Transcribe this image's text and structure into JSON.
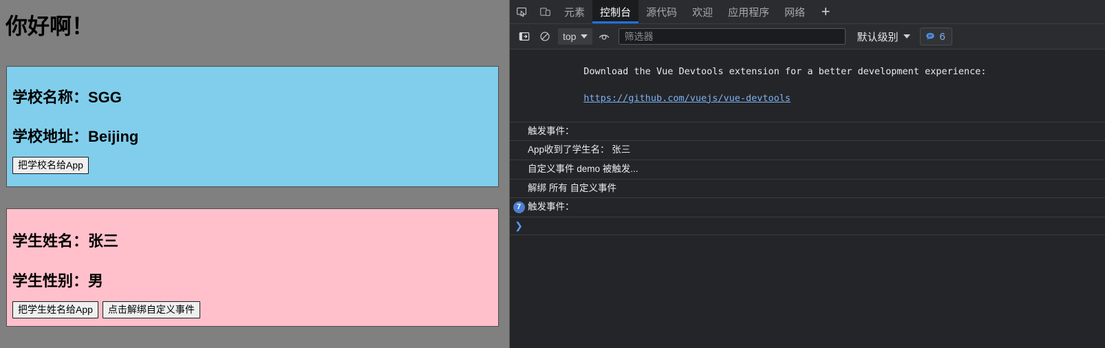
{
  "webpage": {
    "title": "你好啊！",
    "school_card": {
      "name_line": "学校名称：SGG",
      "address_line": "学校地址：Beijing",
      "button_label": "把学校名给App"
    },
    "student_card": {
      "name_line": "学生姓名：张三",
      "gender_line": "学生性别：男",
      "button_send_label": "把学生姓名给App",
      "button_unbind_label": "点击解绑自定义事件"
    },
    "colors": {
      "background": "#808080",
      "school_card": "#80ceeb",
      "student_card": "#ffc0cb"
    }
  },
  "devtools": {
    "tabs": [
      {
        "label": "元素",
        "active": false
      },
      {
        "label": "控制台",
        "active": true
      },
      {
        "label": "源代码",
        "active": false
      },
      {
        "label": "欢迎",
        "active": false
      },
      {
        "label": "应用程序",
        "active": false
      },
      {
        "label": "网络",
        "active": false
      }
    ],
    "add_tab_label": "+",
    "toolbar": {
      "context_value": "top",
      "filter_placeholder": "筛选器",
      "filter_value": "",
      "levels_label": "默认级别",
      "message_count": "6"
    },
    "console": {
      "messages": [
        {
          "id": "vue-devtools",
          "text": "Download the Vue Devtools extension for a better development experience:",
          "link": "https://github.com/vuejs/vue-devtools",
          "count": ""
        },
        {
          "id": "m1",
          "text": "触发事件：",
          "link": "",
          "count": ""
        },
        {
          "id": "m2",
          "text": "App收到了学生名： 张三",
          "link": "",
          "count": ""
        },
        {
          "id": "m3",
          "text": "自定义事件 demo 被触发...",
          "link": "",
          "count": ""
        },
        {
          "id": "m4",
          "text": "解绑 所有 自定义事件",
          "link": "",
          "count": ""
        },
        {
          "id": "m5",
          "text": "触发事件：",
          "link": "",
          "count": "7"
        }
      ],
      "prompt_chevron": "❯",
      "prompt_value": ""
    },
    "colors": {
      "panel_bg": "#242528",
      "toolbar_bg": "#2b2c2f",
      "accent": "#1a73e8",
      "link": "#7cb2f5"
    }
  }
}
